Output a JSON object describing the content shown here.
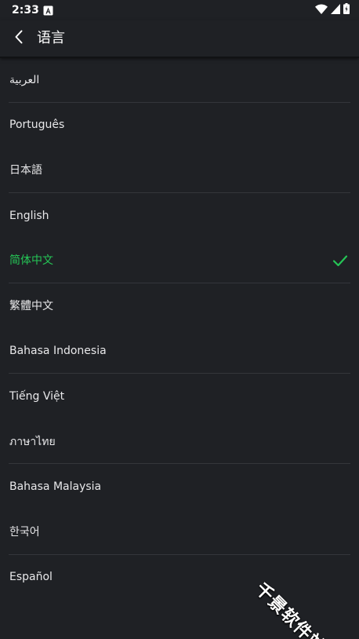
{
  "status_bar": {
    "time": "2:33",
    "icons": [
      "notification-a-icon",
      "wifi-icon",
      "signal-icon",
      "battery-icon"
    ]
  },
  "app_bar": {
    "back_icon": "chevron-left-icon",
    "title": "语言"
  },
  "languages": [
    {
      "label": "العربية",
      "selected": false
    },
    {
      "label": "Português",
      "selected": false
    },
    {
      "label": "日本語",
      "selected": false
    },
    {
      "label": "English",
      "selected": false
    },
    {
      "label": "简体中文",
      "selected": true
    },
    {
      "label": "繁體中文",
      "selected": false
    },
    {
      "label": "Bahasa Indonesia",
      "selected": false
    },
    {
      "label": "Tiếng Việt",
      "selected": false
    },
    {
      "label": "ภาษาไทย",
      "selected": false
    },
    {
      "label": "Bahasa Malaysia",
      "selected": false
    },
    {
      "label": "한국어",
      "selected": false
    },
    {
      "label": "Español",
      "selected": false
    }
  ],
  "watermark": "千景软件站",
  "colors": {
    "background": "#1f2125",
    "selected": "#25c556",
    "text": "#e8e8ea",
    "divider": "#34363b"
  }
}
